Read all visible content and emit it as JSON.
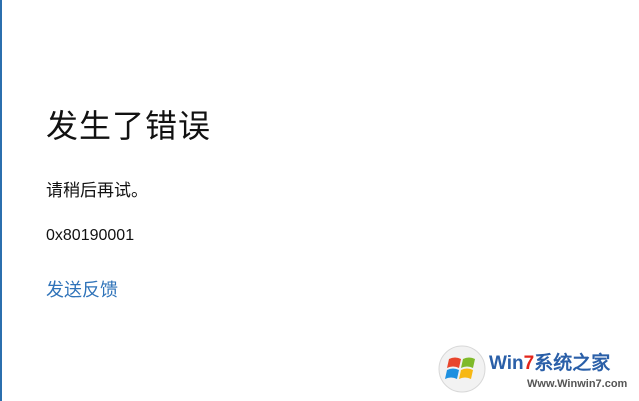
{
  "error": {
    "title": "发生了错误",
    "message": "请稍后再试。",
    "code": "0x80190001",
    "feedback_link": "发送反馈"
  },
  "watermark": {
    "brand_prefix": "Win",
    "brand_seven": "7",
    "brand_suffix": "系统之家",
    "url": "Www.Winwin7.com",
    "logo_icon": "windows-flag-logo"
  },
  "colors": {
    "link": "#2f73b9",
    "text": "#111111",
    "left_edge": "#2b6fae"
  }
}
